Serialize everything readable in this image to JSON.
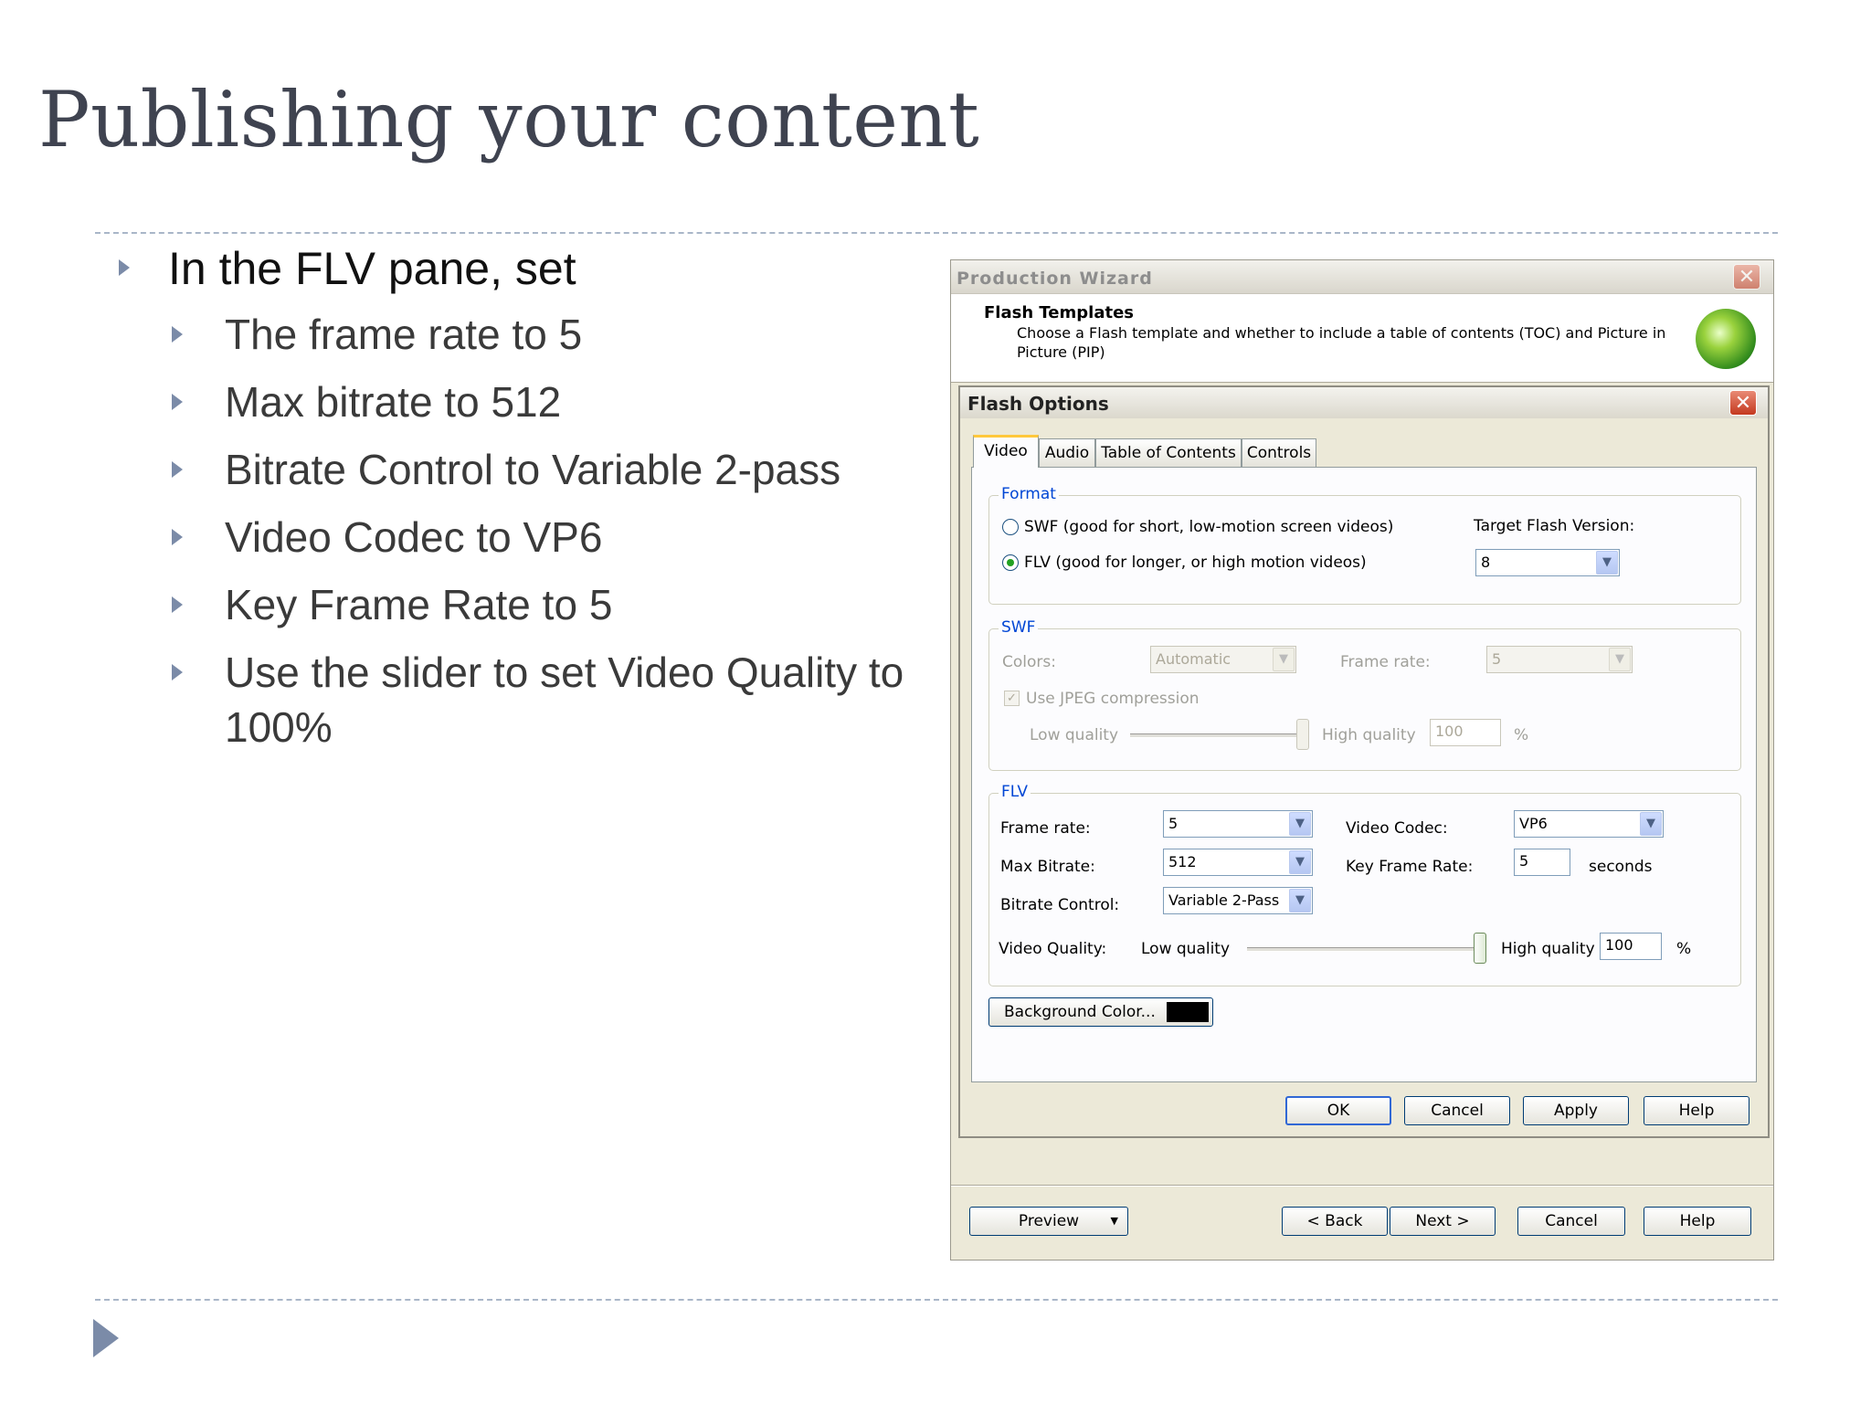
{
  "slide": {
    "title": "Publishing your content",
    "bullets": {
      "main": "In the FLV pane, set",
      "sub": [
        "The frame rate to 5",
        "Max bitrate to 512",
        "Bitrate Control to Variable 2-pass",
        "Video Codec to VP6",
        "Key Frame Rate to 5",
        "Use the slider to set Video Quality to 100%"
      ]
    }
  },
  "production_wizard": {
    "title": "Production Wizard",
    "header_title": "Flash Templates",
    "header_desc": "Choose a Flash template and whether to include a table of contents (TOC) and Picture in Picture (PIP)",
    "buttons": {
      "preview": "Preview",
      "back": "< Back",
      "next": "Next >",
      "cancel": "Cancel",
      "help": "Help"
    }
  },
  "flash_options": {
    "title": "Flash Options",
    "tabs": [
      "Video",
      "Audio",
      "Table of Contents",
      "Controls"
    ],
    "format": {
      "label": "Format",
      "swf_option": "SWF (good for short, low-motion screen videos)",
      "flv_option": "FLV (good for longer, or high motion videos)",
      "selected": "FLV",
      "target_label": "Target Flash Version:",
      "target_value": "8"
    },
    "swf": {
      "label": "SWF",
      "colors_label": "Colors:",
      "colors_value": "Automatic",
      "frame_rate_label": "Frame rate:",
      "frame_rate_value": "5",
      "jpeg_label": "Use JPEG compression",
      "jpeg_checked": true,
      "low_label": "Low quality",
      "high_label": "High quality",
      "quality_value": "100",
      "percent": "%"
    },
    "flv": {
      "label": "FLV",
      "frame_rate_label": "Frame rate:",
      "frame_rate_value": "5",
      "max_bitrate_label": "Max Bitrate:",
      "max_bitrate_value": "512",
      "bitrate_control_label": "Bitrate Control:",
      "bitrate_control_value": "Variable 2-Pass",
      "video_codec_label": "Video Codec:",
      "video_codec_value": "VP6",
      "key_frame_label": "Key Frame Rate:",
      "key_frame_value": "5",
      "seconds": "seconds",
      "video_quality_label": "Video Quality:",
      "low_label": "Low quality",
      "high_label": "High quality",
      "quality_value": "100",
      "quality_fraction": 1.0,
      "percent": "%"
    },
    "background_color_label": "Background Color...",
    "background_color": "#000000",
    "buttons": {
      "ok": "OK",
      "cancel": "Cancel",
      "apply": "Apply",
      "help": "Help"
    }
  }
}
